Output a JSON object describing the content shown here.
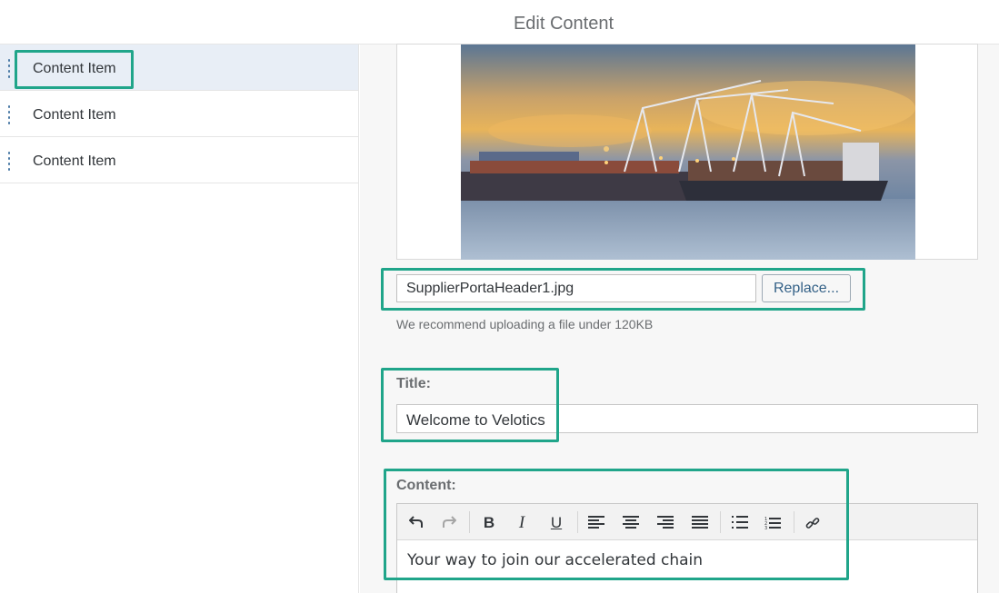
{
  "header": {
    "title": "Edit Content"
  },
  "sidebar": {
    "items": [
      {
        "label": "Content Item",
        "selected": true
      },
      {
        "label": "Content Item",
        "selected": false
      },
      {
        "label": "Content Item",
        "selected": false
      }
    ]
  },
  "image_section": {
    "image_description_icon": "port-image",
    "file_name": "SupplierPortaHeader1.jpg",
    "replace_label": "Replace...",
    "hint": "We recommend uploading a file under 120KB"
  },
  "title_field": {
    "label": "Title:",
    "value": "Welcome to Velotics"
  },
  "content_field": {
    "label": "Content:",
    "toolbar": [
      "undo-icon",
      "redo-icon",
      "bold-icon",
      "italic-icon",
      "underline-icon",
      "align-left-icon",
      "align-center-icon",
      "align-right-icon",
      "align-justify-icon",
      "bullet-list-icon",
      "numbered-list-icon",
      "link-icon"
    ],
    "value": "Your way to join our accelerated chain"
  },
  "colors": {
    "highlight": "#20a58a",
    "selected_item_bg": "#e8eef6",
    "handle": "#4a7aa6"
  }
}
